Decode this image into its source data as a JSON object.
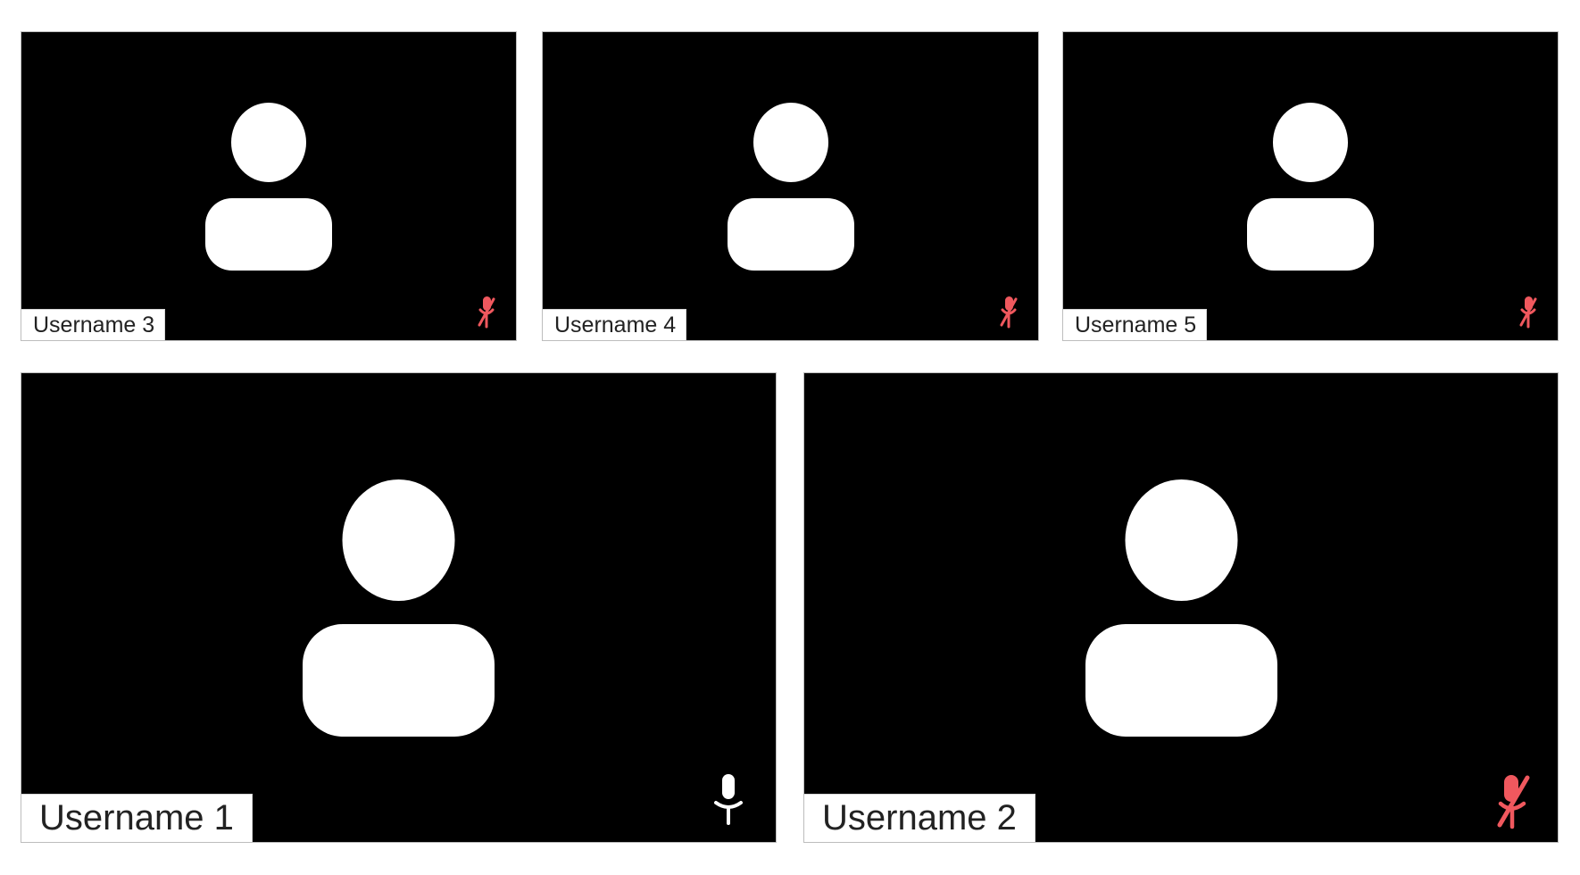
{
  "colors": {
    "tile_background": "#000000",
    "avatar": "#ffffff",
    "label_background": "#ffffff",
    "label_text": "#222222",
    "muted_icon": "#f0585e",
    "unmuted_icon": "#ffffff"
  },
  "participants": {
    "top": [
      {
        "name": "Username 3",
        "mic_state": "muted",
        "mic_icon": "mic-off-icon",
        "avatar_icon": "user-placeholder-icon"
      },
      {
        "name": "Username 4",
        "mic_state": "muted",
        "mic_icon": "mic-off-icon",
        "avatar_icon": "user-placeholder-icon"
      },
      {
        "name": "Username 5",
        "mic_state": "muted",
        "mic_icon": "mic-off-icon",
        "avatar_icon": "user-placeholder-icon"
      }
    ],
    "bottom": [
      {
        "name": "Username 1",
        "mic_state": "unmuted",
        "mic_icon": "mic-icon",
        "avatar_icon": "user-placeholder-icon"
      },
      {
        "name": "Username 2",
        "mic_state": "muted",
        "mic_icon": "mic-off-icon",
        "avatar_icon": "user-placeholder-icon"
      }
    ]
  }
}
